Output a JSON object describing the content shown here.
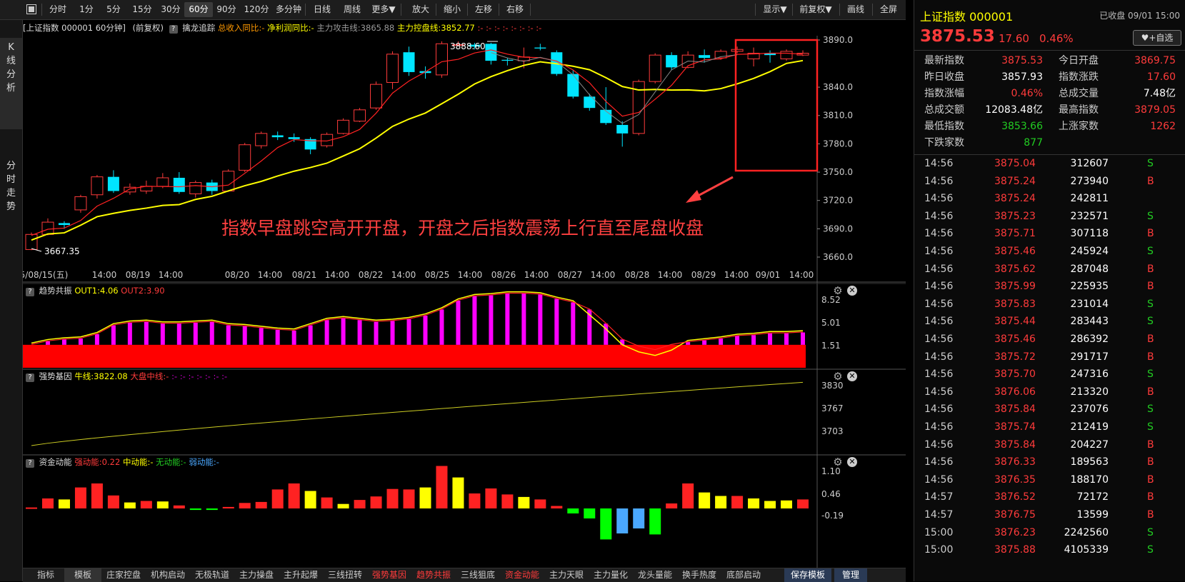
{
  "toolbar": {
    "periods": [
      "分时",
      "1分",
      "5分",
      "15分",
      "30分",
      "60分",
      "90分",
      "120分",
      "多分钟",
      "日线",
      "周线",
      "更多▼"
    ],
    "active": "60分",
    "tools": [
      "放大",
      "缩小",
      "左移",
      "右移"
    ],
    "right": [
      "显示▼",
      "前复权▼",
      "画线",
      "全屏"
    ]
  },
  "left_tabs": {
    "kline": "K线分析",
    "fenshi": "分时走势"
  },
  "chart_header": {
    "title": "[上证指数 000001 60分钟]",
    "adj": "(前复权)",
    "qm": "?",
    "indicator": "擒龙追踪",
    "ind1": "总收入同比:-",
    "ind2": "净利润同比:-",
    "ind3": "主力攻击线:3865.88",
    "ind4": "主力控盘线:3852.77",
    "ind_rest": ":- :- :- :- :- :- :- :-"
  },
  "annotation": "指数早盘跳空高开开盘，开盘之后指数震荡上行直至尾盘收盘",
  "price_labels": {
    "high": "3888.60",
    "low": "3667.35"
  },
  "y_axis_main": [
    "3890.0",
    "3840.0",
    "3810.0",
    "3780.0",
    "3750.0",
    "3720.0",
    "3690.0",
    "3660.0"
  ],
  "x_axis": [
    "2025/08/15(五)",
    "14:00",
    "08/19",
    "14:00",
    "08/20",
    "14:00",
    "08/21",
    "14:00",
    "08/22",
    "14:00",
    "08/25",
    "14:00",
    "08/26",
    "14:00",
    "08/27",
    "14:00",
    "08/28",
    "14:00",
    "08/29",
    "14:00",
    "09/01",
    "14:00"
  ],
  "panel1": {
    "name": "趋势共振",
    "out1": "OUT1:4.06",
    "out2": "OUT2:3.90",
    "axis": [
      "8.52",
      "5.01",
      "1.51"
    ]
  },
  "panel2": {
    "name": "强势基因",
    "line": "牛线:3822.08",
    "line2": "大盘中线:-",
    "rest": ":- :- :- :- :- :- :-",
    "axis": [
      "3830",
      "3767",
      "3703"
    ]
  },
  "panel3": {
    "name": "资金动能",
    "s1": "强动能:0.22",
    "s2": "中动能:-",
    "s3": "无动能:-",
    "s4": "弱动能:-",
    "axis": [
      "1.10",
      "0.46",
      "-0.19"
    ]
  },
  "bottom_tabs": [
    "指标",
    "模板",
    "庄家控盘",
    "机构启动",
    "无极轨道",
    "主力操盘",
    "主升起爆",
    "三线扭转",
    "强势基因",
    "趋势共振",
    "三线狙底",
    "资金动能",
    "主力天眼",
    "主力量化",
    "龙头量能",
    "换手热度",
    "底部启动"
  ],
  "bottom_right": [
    "保存模板",
    "管理"
  ],
  "right_panel": {
    "name": "上证指数 000001",
    "status": "已收盘 09/01 15:00",
    "price": "3875.53",
    "change": "17.60",
    "pct": "0.46%",
    "add_btn": "+自选",
    "stats": [
      {
        "l1": "最新指数",
        "v1": "3875.53",
        "c1": "red",
        "l2": "今日开盘",
        "v2": "3869.75",
        "c2": "red"
      },
      {
        "l1": "昨日收盘",
        "v1": "3857.93",
        "c1": "white",
        "l2": "指数涨跌",
        "v2": "17.60",
        "c2": "red"
      },
      {
        "l1": "指数涨幅",
        "v1": "0.46%",
        "c1": "red",
        "l2": "总成交量",
        "v2": "7.48亿",
        "c2": "white"
      },
      {
        "l1": "总成交额",
        "v1": "12083.48亿",
        "c1": "white",
        "l2": "最高指数",
        "v2": "3879.05",
        "c2": "red"
      },
      {
        "l1": "最低指数",
        "v1": "3853.66",
        "c1": "green",
        "l2": "上涨家数",
        "v2": "1262",
        "c2": "red"
      },
      {
        "l1": "下跌家数",
        "v1": "877",
        "c1": "green",
        "l2": "",
        "v2": "",
        "c2": "white"
      }
    ],
    "ticks": [
      [
        "14:56",
        "3875.04",
        "312607",
        "S"
      ],
      [
        "14:56",
        "3875.24",
        "273940",
        "B"
      ],
      [
        "14:56",
        "3875.24",
        "242811",
        ""
      ],
      [
        "14:56",
        "3875.23",
        "232571",
        "S"
      ],
      [
        "14:56",
        "3875.71",
        "307118",
        "B"
      ],
      [
        "14:56",
        "3875.46",
        "245924",
        "S"
      ],
      [
        "14:56",
        "3875.62",
        "287048",
        "B"
      ],
      [
        "14:56",
        "3875.99",
        "225935",
        "B"
      ],
      [
        "14:56",
        "3875.83",
        "231014",
        "S"
      ],
      [
        "14:56",
        "3875.44",
        "283443",
        "S"
      ],
      [
        "14:56",
        "3875.46",
        "286392",
        "B"
      ],
      [
        "14:56",
        "3875.72",
        "291717",
        "B"
      ],
      [
        "14:56",
        "3875.70",
        "247316",
        "S"
      ],
      [
        "14:56",
        "3876.06",
        "213320",
        "B"
      ],
      [
        "14:56",
        "3875.84",
        "237076",
        "S"
      ],
      [
        "14:56",
        "3875.74",
        "212419",
        "S"
      ],
      [
        "14:56",
        "3875.84",
        "204227",
        "B"
      ],
      [
        "14:56",
        "3876.33",
        "189563",
        "B"
      ],
      [
        "14:56",
        "3876.35",
        "188170",
        "B"
      ],
      [
        "14:57",
        "3876.52",
        "72172",
        "B"
      ],
      [
        "14:57",
        "3876.75",
        "13599",
        "B"
      ],
      [
        "15:00",
        "3876.23",
        "2242560",
        "S"
      ],
      [
        "15:00",
        "3875.88",
        "4105339",
        "S"
      ]
    ]
  },
  "colors": {
    "up": "#ff3b3b",
    "down": "#00e5ff",
    "ma_red": "#ff2222",
    "ma_yellow": "#ffff00",
    "ma_gray": "#888888",
    "magenta": "#ff00ff",
    "accent_box": "#ff2222"
  },
  "chart_data": [
    {
      "type": "candlestick",
      "title": "上证指数 000001 60分钟",
      "x": [
        "08/15-1",
        "08/15-2",
        "08/15-3",
        "08/15-4",
        "08/18-1",
        "08/18-2",
        "08/18-3",
        "08/18-4",
        "08/19-1",
        "08/19-2",
        "08/19-3",
        "08/19-4",
        "08/20-1",
        "08/20-2",
        "08/20-3",
        "08/20-4",
        "08/21-1",
        "08/21-2",
        "08/21-3",
        "08/21-4",
        "08/22-1",
        "08/22-2",
        "08/22-3",
        "08/22-4",
        "08/25-1",
        "08/25-2",
        "08/25-3",
        "08/25-4",
        "08/26-1",
        "08/26-2",
        "08/26-3",
        "08/26-4",
        "08/27-1",
        "08/27-2",
        "08/27-3",
        "08/27-4",
        "08/28-1",
        "08/28-2",
        "08/28-3",
        "08/28-4",
        "08/29-1",
        "08/29-2",
        "08/29-3",
        "08/29-4",
        "09/01-1",
        "09/01-2",
        "09/01-3",
        "09/01-4"
      ],
      "ohlc": [
        [
          3668,
          3684,
          3667.35,
          3686
        ],
        [
          3684,
          3697,
          3683,
          3701
        ],
        [
          3696,
          3694,
          3690,
          3698
        ],
        [
          3710,
          3724,
          3707,
          3726
        ],
        [
          3726,
          3745,
          3722,
          3747
        ],
        [
          3745,
          3730,
          3728,
          3752
        ],
        [
          3729,
          3734,
          3726,
          3738
        ],
        [
          3730,
          3735,
          3727,
          3741
        ],
        [
          3735,
          3744,
          3733,
          3749
        ],
        [
          3744,
          3729,
          3727,
          3750
        ],
        [
          3727,
          3739,
          3723,
          3741
        ],
        [
          3739,
          3730,
          3726,
          3742
        ],
        [
          3730,
          3751,
          3729,
          3753
        ],
        [
          3752,
          3779,
          3750,
          3781
        ],
        [
          3778,
          3791,
          3775,
          3793
        ],
        [
          3789,
          3787,
          3784,
          3793
        ],
        [
          3787,
          3785,
          3782,
          3791
        ],
        [
          3785,
          3774,
          3769,
          3787
        ],
        [
          3778,
          3790,
          3776,
          3792
        ],
        [
          3791,
          3805,
          3790,
          3807
        ],
        [
          3804,
          3816,
          3803,
          3818
        ],
        [
          3818,
          3843,
          3816,
          3846
        ],
        [
          3845,
          3875,
          3838,
          3878
        ],
        [
          3877,
          3856,
          3852,
          3883
        ],
        [
          3857,
          3855,
          3849,
          3862
        ],
        [
          3853,
          3886,
          3850,
          3888.6
        ],
        [
          3885,
          3885,
          3884,
          3888.6
        ],
        [
          3885,
          3883,
          3880,
          3887
        ],
        [
          3886,
          3868,
          3864,
          3887
        ],
        [
          3869,
          3868,
          3863,
          3871
        ],
        [
          3868,
          3872,
          3860,
          3882
        ],
        [
          3882,
          3881,
          3879,
          3886
        ],
        [
          3877,
          3854,
          3852,
          3879
        ],
        [
          3854,
          3830,
          3828,
          3858
        ],
        [
          3830,
          3818,
          3815,
          3833
        ],
        [
          3816,
          3802,
          3800,
          3840
        ],
        [
          3800,
          3791,
          3777,
          3804
        ],
        [
          3791,
          3846,
          3789,
          3848
        ],
        [
          3846,
          3874,
          3844,
          3876
        ],
        [
          3874,
          3861,
          3858,
          3877
        ],
        [
          3861,
          3874,
          3860,
          3878
        ],
        [
          3874,
          3871,
          3866,
          3880
        ],
        [
          3871,
          3878,
          3869,
          3880
        ],
        [
          3878,
          3880,
          3876,
          3883
        ],
        [
          3870,
          3876,
          3862,
          3882
        ],
        [
          3876,
          3874,
          3866,
          3879
        ],
        [
          3870,
          3878,
          3868,
          3880
        ],
        [
          3874,
          3876,
          3873,
          3879
        ]
      ],
      "ylim": [
        3660,
        3890
      ]
    }
  ]
}
